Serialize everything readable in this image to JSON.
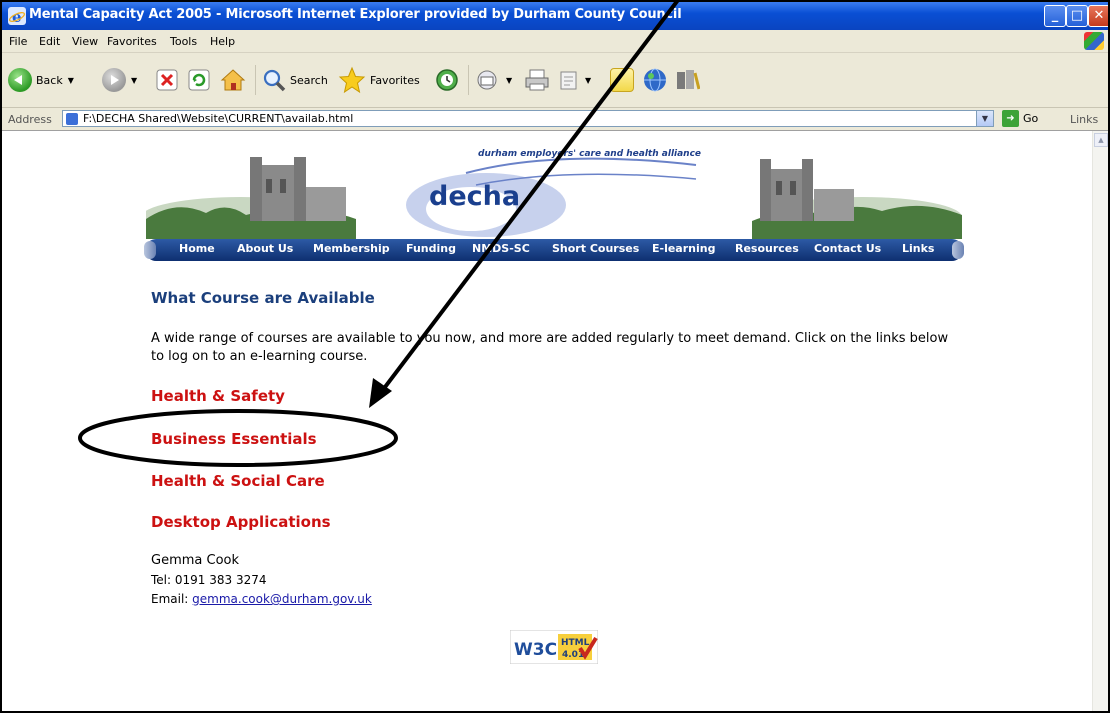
{
  "window": {
    "title": "Mental Capacity Act 2005 - Microsoft Internet Explorer provided by Durham County Council",
    "controls": {
      "minimize": "_",
      "maximize": "□",
      "close": "✕"
    }
  },
  "menu": [
    "File",
    "Edit",
    "View",
    "Favorites",
    "Tools",
    "Help"
  ],
  "toolbar": {
    "back_label": "Back",
    "search_label": "Search",
    "favorites_label": "Favorites"
  },
  "address": {
    "label": "Address",
    "value": "F:\\DECHA Shared\\Website\\CURRENT\\availab.html",
    "go_label": "Go",
    "links_label": "Links"
  },
  "site": {
    "tagline": "durham employers' care and health alliance",
    "logo_text": "decha",
    "nav": [
      "Home",
      "About Us",
      "Membership",
      "Funding",
      "NMDS-SC",
      "Short Courses",
      "E-learning",
      "Resources",
      "Contact Us",
      "Links"
    ]
  },
  "content": {
    "heading": "What Course are Available",
    "intro": "A wide range of courses are available to you now, and more are added regularly to meet demand. Click on the links below to log on to an e-learning course.",
    "courses": [
      "Health & Safety",
      "Business Essentials",
      "Health & Social Care",
      "Desktop Applications"
    ],
    "contact_name": "Gemma Cook",
    "contact_tel": "Tel: 0191 383 3274",
    "contact_email_label": "Email: ",
    "contact_email": "gemma.cook@durham.gov.uk",
    "badge": {
      "w3c": "W3C",
      "html": "HTML",
      "version": "4.01"
    }
  },
  "colors": {
    "title_bar": "#0a4fd4",
    "chrome": "#ece9d8",
    "nav_bar": "#0e2f70",
    "heading": "#1b3f7c",
    "course_link": "#cc1111",
    "email_link": "#1a1aa8"
  },
  "annotation": {
    "highlighted_item": "Business Essentials",
    "marks": [
      "arrow",
      "ellipse"
    ]
  }
}
